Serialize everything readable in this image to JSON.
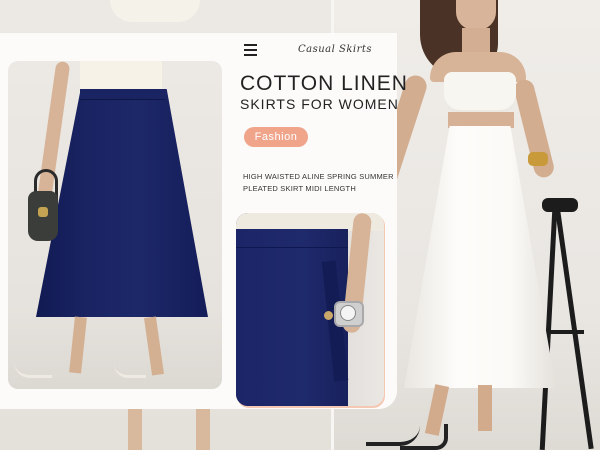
{
  "header": {
    "brand": "Casual Skirts",
    "menu_icon": "hamburger-menu-icon"
  },
  "title": {
    "line1": "COTTON LINEN",
    "line2": "SKIRTS FOR WOMEN"
  },
  "badge": {
    "label": "Fashion",
    "color": "#f0a48a"
  },
  "description": {
    "line1": "HIGH WAISTED ALINE SPRING SUMMER",
    "line2": "PLEATED SKIRT MIDI LENGTH"
  },
  "colors": {
    "skirt_navy": "#1d2869",
    "skirt_white": "#fbfaf7",
    "accent": "#f0a48a"
  }
}
